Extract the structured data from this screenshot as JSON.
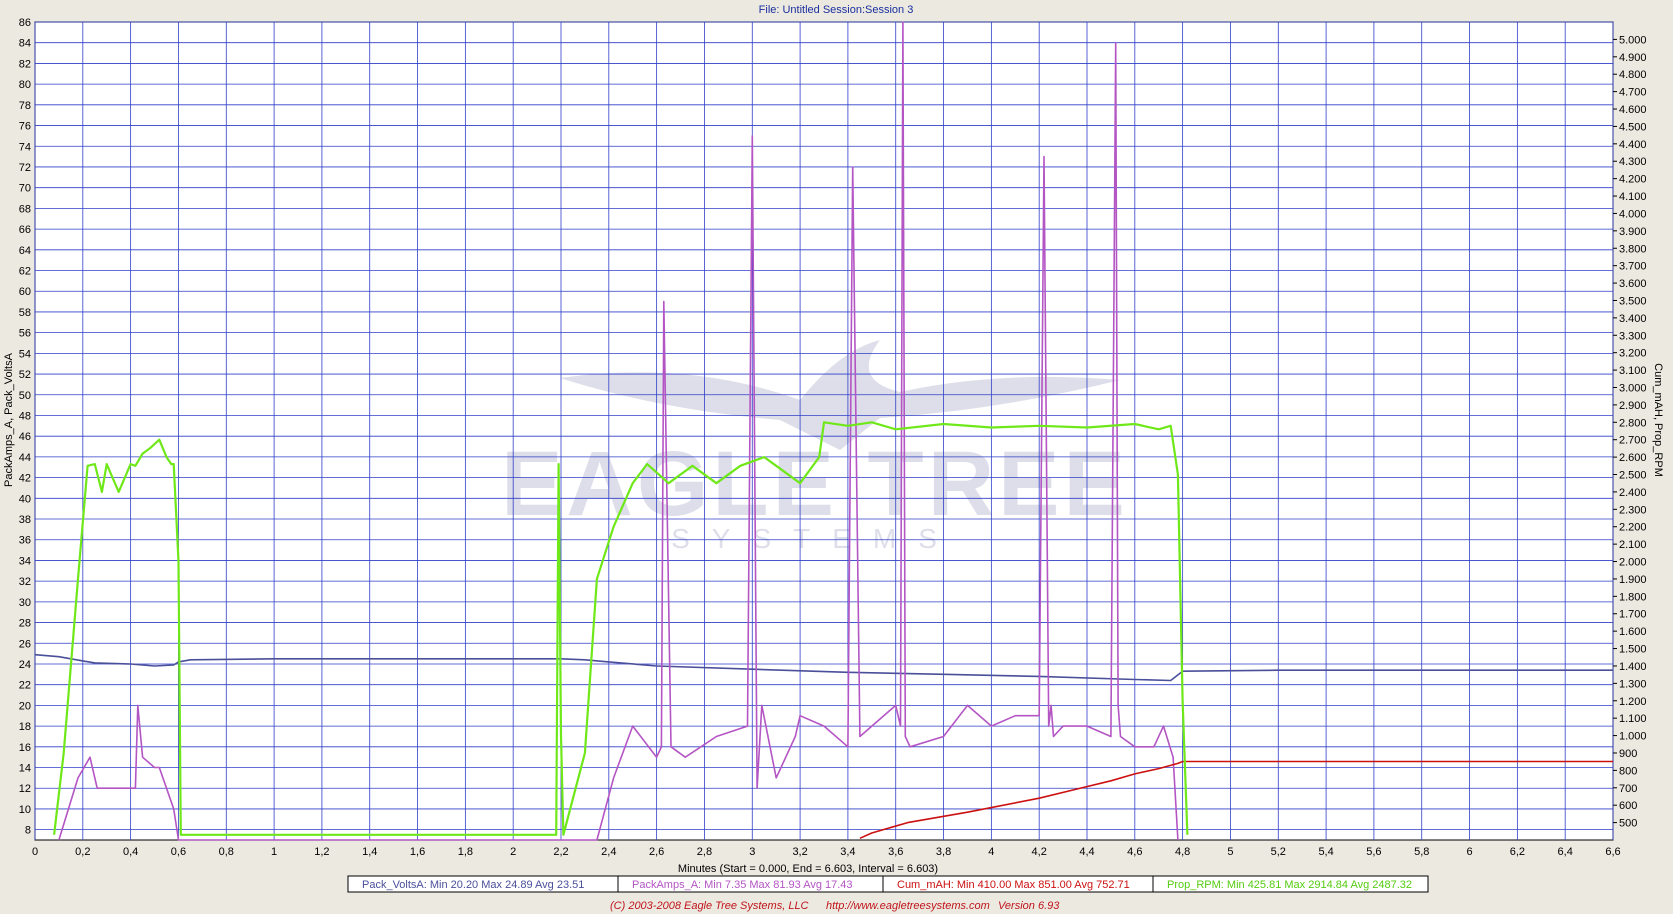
{
  "header": {
    "title": "File: Untitled    Session:Session 3"
  },
  "footer": {
    "copyright": "(C) 2003-2008 Eagle Tree Systems, LLC",
    "url": "http://www.eagletreesystems.com",
    "version": "Version 6.93"
  },
  "watermark": {
    "line1": "EAGLE TREE",
    "line2": "SYSTEMS"
  },
  "colors": {
    "grid": "#2f3fc8",
    "volts": "#4a4f9a",
    "amps": "#b455c4",
    "mah": "#cc1111",
    "rpm": "#6fe819",
    "header": "#1a2f9e"
  },
  "legend": [
    {
      "name": "Pack_VoltsA",
      "stats": "Min 20.20   Max 24.89   Avg 23.51",
      "color": "#4a4f9a"
    },
    {
      "name": "PackAmps_A",
      "stats": "Min 7.35   Max 81.93   Avg 17.43",
      "color": "#b455c4"
    },
    {
      "name": "Cum_mAH",
      "stats": "Min 410.00   Max 851.00   Avg 752.71",
      "color": "#cc1111"
    },
    {
      "name": "Prop_RPM",
      "stats": "Min 425.81   Max 2914.84   Avg 2487.32",
      "color": "#55cc11"
    }
  ],
  "chart_data": {
    "type": "line",
    "xlabel": "Minutes (Start = 0.000,  End = 6.603,  Interval =  6.603)",
    "ylabel_left": "PackAmps_A, Pack_VoltsA",
    "ylabel_right": "Cum_mAH, Prop_RPM",
    "xlim": [
      0,
      6.6
    ],
    "ylim_left": [
      7,
      86
    ],
    "ylim_right": [
      400,
      5100
    ],
    "x_ticks": [
      "0",
      "0,2",
      "0,4",
      "0,6",
      "0,8",
      "1",
      "1,2",
      "1,4",
      "1,6",
      "1,8",
      "2",
      "2,2",
      "2,4",
      "2,6",
      "2,8",
      "3",
      "3,2",
      "3,4",
      "3,6",
      "3,8",
      "4",
      "4,2",
      "4,4",
      "4,6",
      "4,8",
      "5",
      "5,2",
      "5,4",
      "5,6",
      "5,8",
      "6",
      "6,2",
      "6,4",
      "6,6"
    ],
    "y_left_ticks": [
      "8",
      "10",
      "12",
      "14",
      "16",
      "18",
      "20",
      "22",
      "24",
      "26",
      "28",
      "30",
      "32",
      "34",
      "36",
      "38",
      "40",
      "42",
      "44",
      "46",
      "48",
      "50",
      "52",
      "54",
      "56",
      "58",
      "60",
      "62",
      "64",
      "66",
      "68",
      "70",
      "72",
      "74",
      "76",
      "78",
      "80",
      "82",
      "84",
      "86"
    ],
    "y_right_ticks": [
      "500",
      "600",
      "700",
      "800",
      "900",
      "1.000",
      "1.100",
      "1.200",
      "1.300",
      "1.400",
      "1.500",
      "1.600",
      "1.700",
      "1.800",
      "1.900",
      "2.000",
      "2.100",
      "2.200",
      "2.300",
      "2.400",
      "2.500",
      "2.600",
      "2.700",
      "2.800",
      "2.900",
      "3.000",
      "3.100",
      "3.200",
      "3.300",
      "3.400",
      "3.500",
      "3.600",
      "3.700",
      "3.800",
      "3.900",
      "4.000",
      "4.100",
      "4.200",
      "4.300",
      "4.400",
      "4.500",
      "4.600",
      "4.700",
      "4.800",
      "4.900",
      "5.000"
    ],
    "grid": true,
    "series": [
      {
        "name": "Pack_VoltsA",
        "axis": "left",
        "x": [
          0,
          0.1,
          0.2,
          0.25,
          0.4,
          0.5,
          0.58,
          0.6,
          0.65,
          1.0,
          1.5,
          2.0,
          2.2,
          2.3,
          2.4,
          2.6,
          3.0,
          3.4,
          3.8,
          4.2,
          4.6,
          4.75,
          4.8,
          5.2,
          6.6
        ],
        "y": [
          24.9,
          24.7,
          24.3,
          24.1,
          24.0,
          23.8,
          23.9,
          24.2,
          24.4,
          24.5,
          24.5,
          24.5,
          24.5,
          24.4,
          24.2,
          23.8,
          23.5,
          23.2,
          23.0,
          22.8,
          22.5,
          22.4,
          23.3,
          23.4,
          23.4
        ]
      },
      {
        "name": "PackAmps_A",
        "axis": "left",
        "x": [
          0.1,
          0.18,
          0.23,
          0.26,
          0.3,
          0.38,
          0.42,
          0.43,
          0.45,
          0.5,
          0.52,
          0.55,
          0.58,
          0.6,
          2.35,
          2.42,
          2.5,
          2.6,
          2.62,
          2.63,
          2.66,
          2.72,
          2.85,
          2.98,
          3.0,
          3.02,
          3.04,
          3.1,
          3.18,
          3.2,
          3.3,
          3.4,
          3.42,
          3.45,
          3.6,
          3.62,
          3.63,
          3.64,
          3.66,
          3.8,
          3.9,
          4.0,
          4.1,
          4.2,
          4.22,
          4.24,
          4.25,
          4.26,
          4.3,
          4.4,
          4.5,
          4.52,
          4.53,
          4.54,
          4.6,
          4.68,
          4.72,
          4.76,
          4.78
        ],
        "y": [
          7,
          13,
          15,
          12,
          12,
          12,
          12,
          20,
          15,
          14,
          14,
          12,
          10,
          7,
          7,
          13,
          18,
          15,
          16,
          59,
          16,
          15,
          17,
          18,
          75,
          12,
          20,
          13,
          17,
          19,
          18,
          16,
          72,
          17,
          20,
          18,
          86,
          17,
          16,
          17,
          20,
          18,
          19,
          19,
          73,
          18,
          20,
          17,
          18,
          18,
          17,
          84,
          20,
          17,
          16,
          16,
          18,
          15,
          7
        ]
      },
      {
        "name": "Cum_mAH",
        "axis": "right",
        "x": [
          3.45,
          3.5,
          3.65,
          3.9,
          4.2,
          4.35,
          4.5,
          4.6,
          4.7,
          4.78,
          4.8,
          5.2,
          5.8,
          6.6
        ],
        "y": [
          410,
          440,
          500,
          560,
          640,
          690,
          740,
          780,
          810,
          840,
          851,
          851,
          851,
          851
        ]
      },
      {
        "name": "Prop_RPM",
        "axis": "right",
        "x": [
          0.08,
          0.12,
          0.18,
          0.22,
          0.25,
          0.28,
          0.3,
          0.35,
          0.4,
          0.42,
          0.45,
          0.48,
          0.52,
          0.55,
          0.57,
          0.58,
          0.6,
          0.61,
          2.18,
          2.19,
          2.2,
          2.21,
          2.3,
          2.35,
          2.42,
          2.5,
          2.56,
          2.65,
          2.75,
          2.85,
          2.95,
          3.05,
          3.1,
          3.2,
          3.28,
          3.3,
          3.4,
          3.5,
          3.6,
          3.8,
          4.0,
          4.2,
          4.4,
          4.6,
          4.7,
          4.75,
          4.78,
          4.8,
          4.82
        ],
        "y": [
          430,
          900,
          1900,
          2550,
          2560,
          2400,
          2560,
          2400,
          2560,
          2550,
          2620,
          2650,
          2700,
          2600,
          2560,
          2560,
          2000,
          430,
          430,
          2560,
          1000,
          430,
          900,
          1900,
          2200,
          2450,
          2560,
          2450,
          2550,
          2450,
          2550,
          2600,
          2550,
          2450,
          2600,
          2800,
          2780,
          2800,
          2760,
          2790,
          2770,
          2780,
          2770,
          2790,
          2760,
          2780,
          2500,
          1200,
          430
        ]
      }
    ]
  }
}
